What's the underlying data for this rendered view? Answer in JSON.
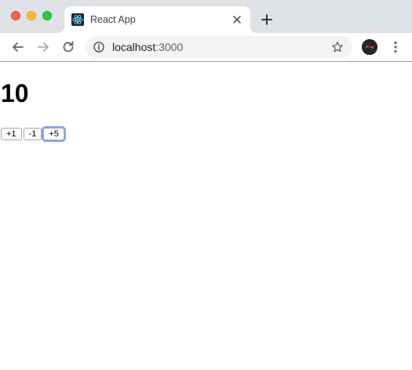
{
  "browser": {
    "tab": {
      "title": "React App",
      "favicon": "react-atom-icon",
      "favicon_color": "#61dafb"
    },
    "url": {
      "host": "localhost",
      "port": ":3000"
    },
    "icons": {
      "back": "arrow-left-icon",
      "forward": "arrow-right-icon",
      "reload": "reload-icon",
      "info": "info-icon",
      "bookmark": "star-icon",
      "menu": "three-dots-icon",
      "new_tab": "plus-icon",
      "close_tab": "close-icon"
    }
  },
  "page": {
    "count": "10",
    "buttons": [
      {
        "label": "+1"
      },
      {
        "label": "-1"
      },
      {
        "label": "+5",
        "focused": true
      }
    ],
    "colors": {
      "focus_ring": "#7fa6f2"
    }
  }
}
